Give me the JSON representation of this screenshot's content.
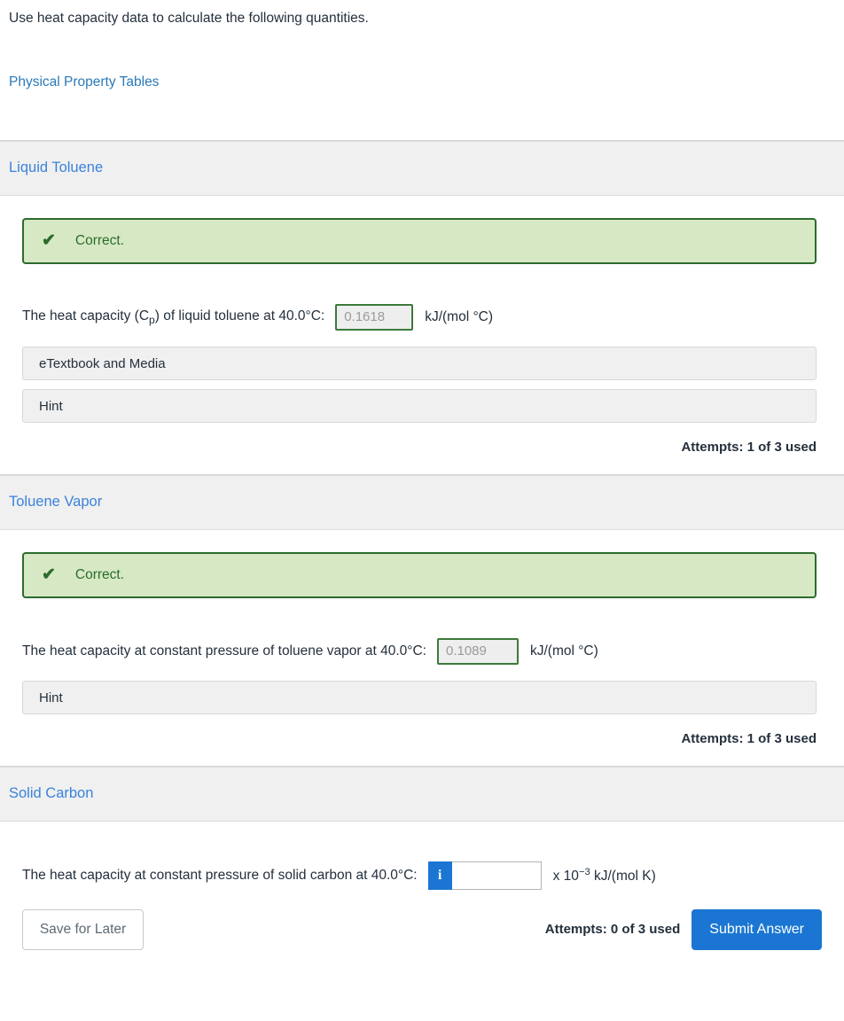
{
  "intro": {
    "prompt": "Use heat capacity data to calculate the following quantities.",
    "link_label": "Physical Property Tables"
  },
  "sections": [
    {
      "title": "Liquid Toluene",
      "alert": {
        "icon": "check-icon",
        "text": "Correct."
      },
      "question": {
        "prefix": "The heat capacity (C",
        "subscript": "p",
        "suffix": ") of liquid toluene at 40.0°C:",
        "value": "0.1618",
        "unit": "kJ/(mol °C)"
      },
      "buttons": [
        "eTextbook and Media",
        "Hint"
      ],
      "attempts": "Attempts: 1 of 3 used"
    },
    {
      "title": "Toluene Vapor",
      "alert": {
        "icon": "check-icon",
        "text": "Correct."
      },
      "question": {
        "prefix": "The heat capacity at constant pressure of toluene vapor at 40.0°C:",
        "value": "0.1089",
        "unit": "kJ/(mol °C)"
      },
      "buttons": [
        "Hint"
      ],
      "attempts": "Attempts: 1 of 3 used"
    },
    {
      "title": "Solid Carbon",
      "question": {
        "prefix": "The heat capacity at constant pressure of solid carbon at 40.0°C:",
        "value": "",
        "info_icon_label": "i",
        "unit_prefix": "x 10",
        "unit_exponent": "−3",
        "unit_suffix": "kJ/(mol K)"
      },
      "attempts": "Attempts: 0 of 3 used"
    }
  ],
  "footer": {
    "save_label": "Save for Later",
    "submit_label": "Submit Answer"
  },
  "colors": {
    "link": "#3b82dc",
    "correct_border": "#2d6b2d",
    "correct_bg": "#d6e9c4",
    "primary": "#1a76d2",
    "section_bg": "#f0f0f0"
  }
}
